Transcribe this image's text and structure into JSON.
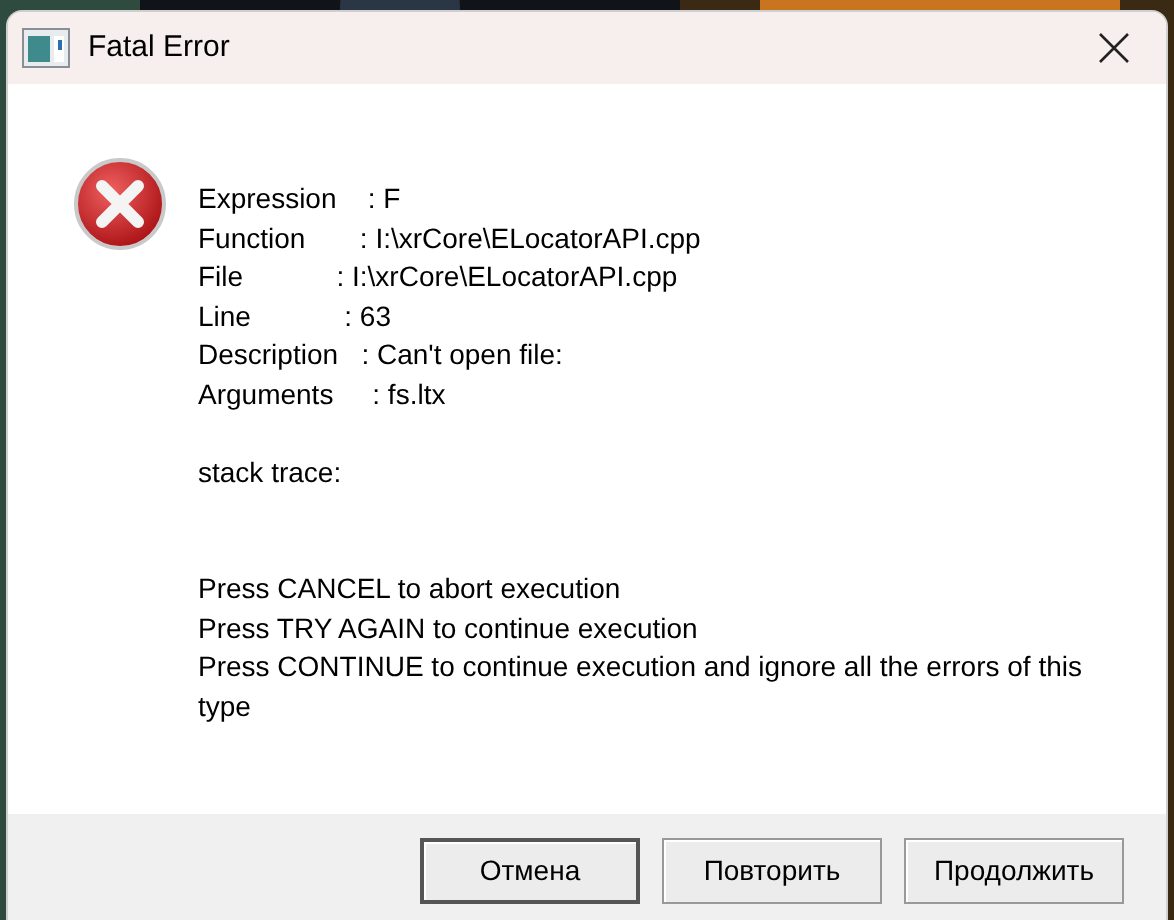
{
  "window": {
    "title": "Fatal Error"
  },
  "details": [
    "Expression    : F",
    "Function       : I:\\xrCore\\ELocatorAPI.cpp",
    "File            : I:\\xrCore\\ELocatorAPI.cpp",
    "Line            : 63",
    "Description   : Can't open file:",
    "Arguments     : fs.ltx"
  ],
  "stack_label": "stack trace:",
  "instructions": [
    "Press CANCEL to abort execution",
    "Press TRY AGAIN to continue execution",
    "Press CONTINUE to continue execution and ignore all the errors of this type"
  ],
  "buttons": [
    {
      "label": "Отмена",
      "default": true
    },
    {
      "label": "Повторить",
      "default": false
    },
    {
      "label": "Продолжить",
      "default": false
    }
  ]
}
